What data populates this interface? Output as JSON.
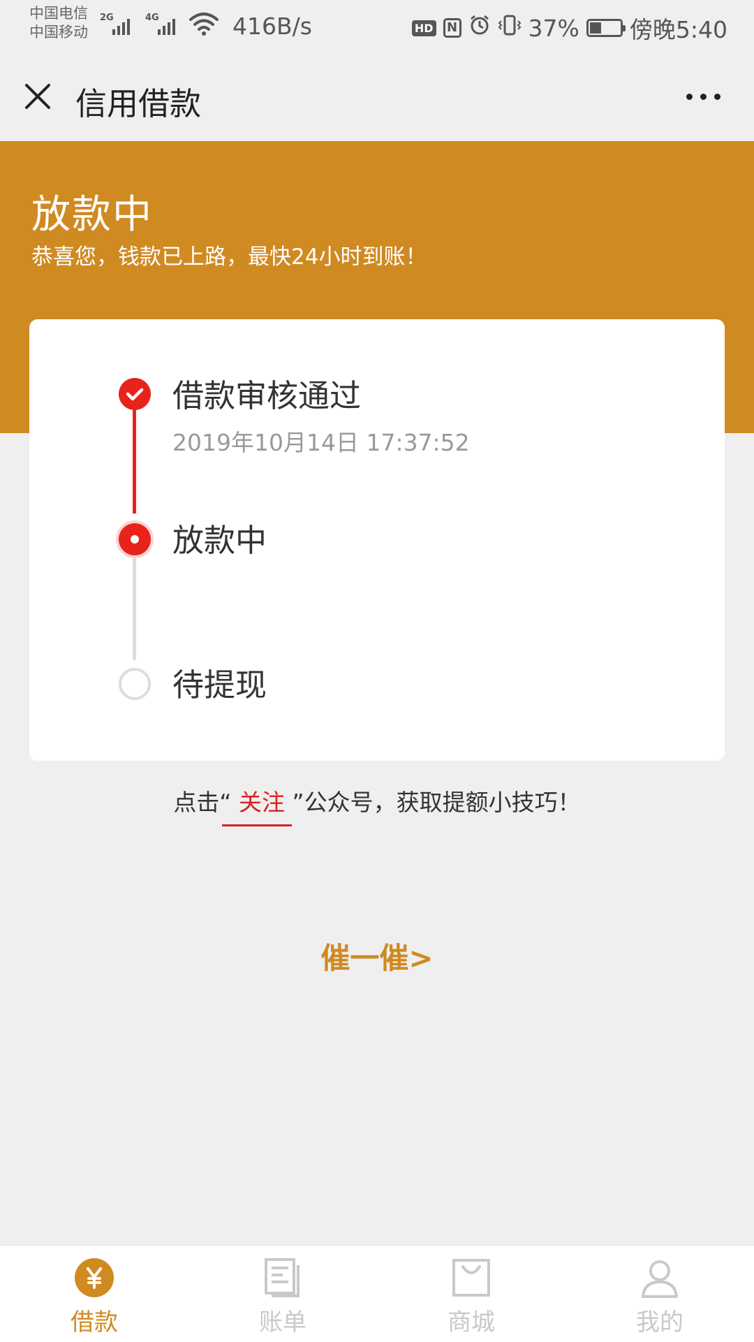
{
  "status_bar": {
    "carrier_1": "中国电信",
    "carrier_2": "中国移动",
    "net_1": "2G",
    "net_2": "4G",
    "speed": "416B/s",
    "hd": "HD",
    "nfc": "N",
    "battery_percent": "37%",
    "battery_level": 0.37,
    "time": "傍晚5:40"
  },
  "nav": {
    "title": "信用借款"
  },
  "banner": {
    "title": "放款中",
    "subtitle": "恭喜您，钱款已上路，最快24小时到账！"
  },
  "steps": [
    {
      "title": "借款审核通过",
      "time": "2019年10月14日 17:37:52",
      "state": "done"
    },
    {
      "title": "放款中",
      "time": "",
      "state": "current"
    },
    {
      "title": "待提现",
      "time": "",
      "state": "pending"
    }
  ],
  "follow": {
    "prefix": "点击“ ",
    "link": "关注",
    "suffix": " ”公众号，获取提额小技巧！"
  },
  "urge_label": "催一催>",
  "tabs": [
    {
      "label": "借款",
      "icon": "yen-icon",
      "active": true
    },
    {
      "label": "账单",
      "icon": "bill-icon",
      "active": false
    },
    {
      "label": "商城",
      "icon": "shop-bag-icon",
      "active": false
    },
    {
      "label": "我的",
      "icon": "user-icon",
      "active": false
    }
  ],
  "colors": {
    "accent": "#d08a22",
    "step_active": "#e8231b",
    "step_inactive": "#dddddd",
    "link_red": "#d92121",
    "tab_inactive": "#c9c9c9"
  }
}
